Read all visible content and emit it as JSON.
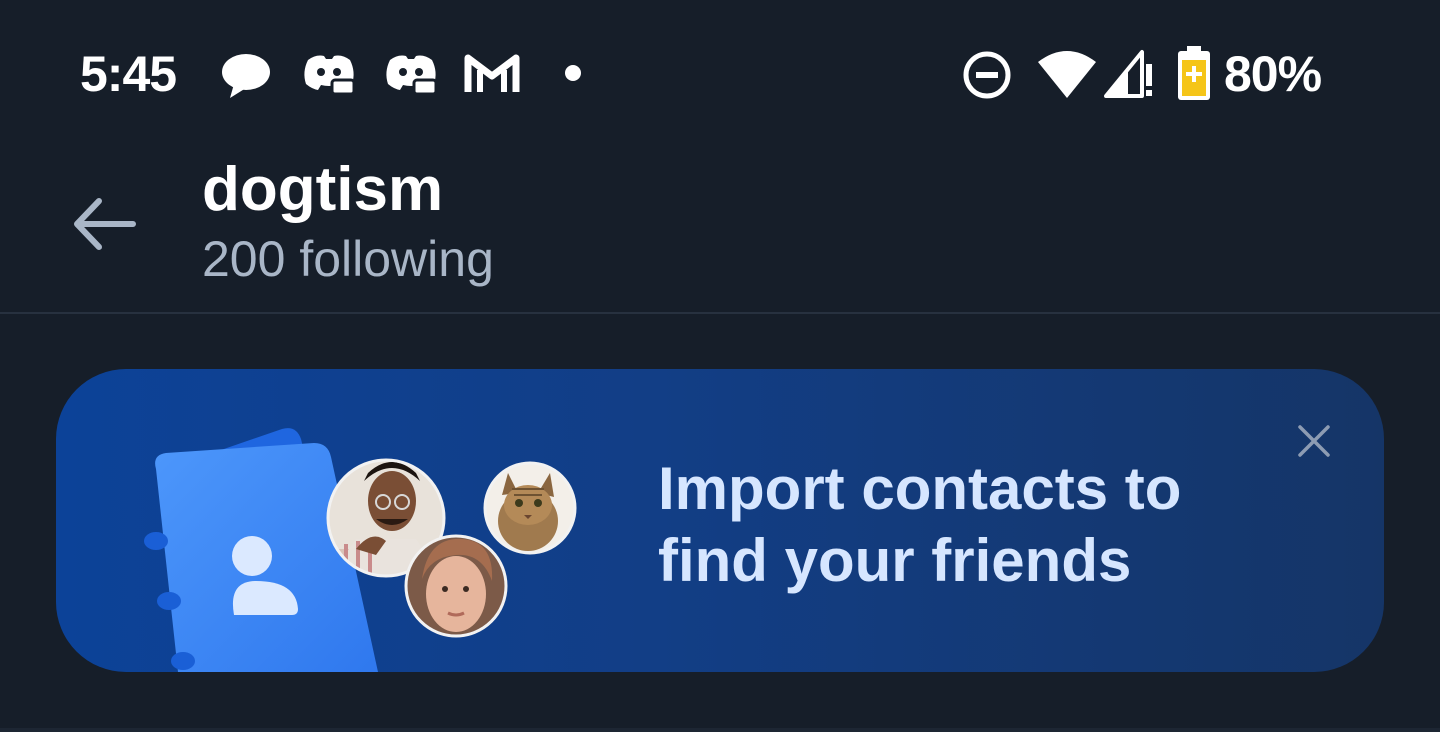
{
  "status_bar": {
    "time": "5:45",
    "notification_icons": [
      "chat-bubble-icon",
      "discord-icon",
      "discord-icon",
      "gmail-icon",
      "dot-icon"
    ],
    "system_icons": [
      "do-not-disturb-icon",
      "wifi-icon",
      "cell-signal-icon",
      "battery-charging-icon"
    ],
    "battery_percent": "80%"
  },
  "header": {
    "title": "dogtism",
    "subtitle": "200 following",
    "back_icon": "arrow-left-icon"
  },
  "banner": {
    "text": "Import contacts to find your friends",
    "close_icon": "close-icon",
    "colors": {
      "background": "#0c4298",
      "text": "#d6e6ff",
      "book": "#3f8cf7"
    }
  },
  "colors": {
    "background": "#161e29",
    "subtitle": "#a9b6c7",
    "battery_fill": "#f5c518"
  }
}
